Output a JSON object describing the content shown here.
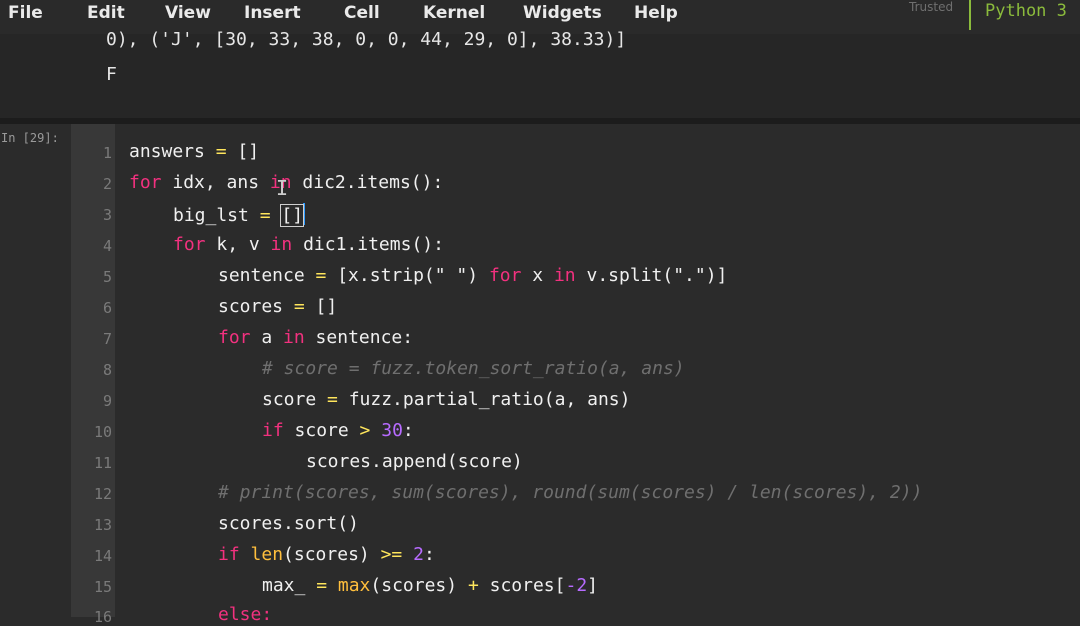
{
  "menu": {
    "items": [
      "File",
      "Edit",
      "View",
      "Insert",
      "Cell",
      "Kernel",
      "Widgets",
      "Help"
    ],
    "trusted": "Trusted",
    "kernel": "Python 3"
  },
  "prev_output": {
    "line1": "0), ('J', [30, 33, 38, 0, 0, 44, 29, 0], 38.33)]",
    "line2": "F"
  },
  "cell": {
    "prompt": "In [29]:",
    "line_numbers": [
      "1",
      "2",
      "3",
      "4",
      "5",
      "6",
      "7",
      "8",
      "9",
      "10",
      "11",
      "12",
      "13",
      "14",
      "15",
      "16"
    ]
  },
  "code": {
    "l1": {
      "a": "answers",
      "b": " = ",
      "c": "[]"
    },
    "l2": {
      "a": "for",
      "b": " idx, ans ",
      "c": "in",
      "d": " dic2.items():"
    },
    "l3": {
      "a": "big_lst",
      "b": " = ",
      "c": "[]"
    },
    "l4": {
      "a": "for",
      "b": " k, v ",
      "c": "in",
      "d": " dic1.items():"
    },
    "l5": {
      "a": "sentence",
      "b": " = ",
      "c": "[x.strip(\" \") ",
      "d": "for",
      "e": " x ",
      "f": "in",
      "g": " v.split(\".\")]"
    },
    "l6": {
      "a": "scores",
      "b": " = ",
      "c": "[]"
    },
    "l7": {
      "a": "for",
      "b": " a ",
      "c": "in",
      "d": " sentence:"
    },
    "l8": {
      "a": "# score = fuzz.token_sort_ratio(a, ans)"
    },
    "l9": {
      "a": "score",
      "b": " = ",
      "c": "fuzz.partial_ratio(a, ans)"
    },
    "l10": {
      "a": "if",
      "b": " score ",
      "c": ">",
      "d": " ",
      "e": "30",
      "f": ":"
    },
    "l11": {
      "a": "scores.append(score)"
    },
    "l12": {
      "a": "# print(scores, sum(scores), round(sum(scores) / len(scores), 2))"
    },
    "l13": {
      "a": "scores.sort()"
    },
    "l14": {
      "a": "if",
      "b": " ",
      "c": "len",
      "d": "(scores) ",
      "e": ">=",
      "f": " ",
      "g": "2",
      "h": ":"
    },
    "l15": {
      "a": "max_",
      "b": " = ",
      "c": "max",
      "d": "(scores) ",
      "e": "+",
      "f": " scores[",
      "g": "-2",
      "h": "]"
    },
    "l16": {
      "a": "else:"
    }
  }
}
